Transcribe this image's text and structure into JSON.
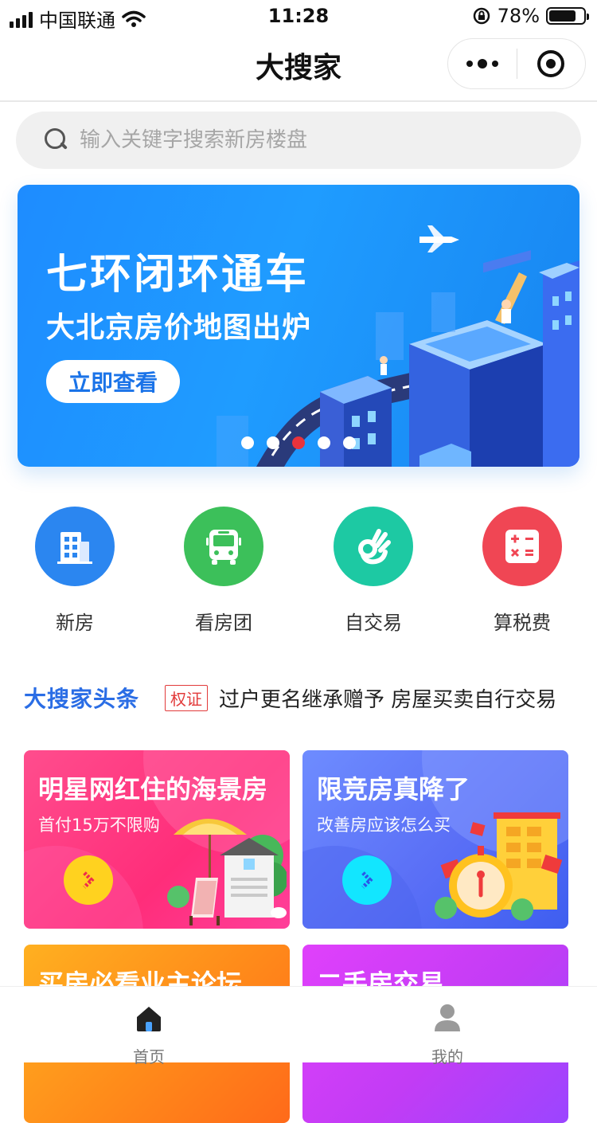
{
  "status_bar": {
    "carrier": "中国联通",
    "time": "11:28",
    "battery_pct": "78%",
    "battery_level": 0.78
  },
  "nav": {
    "title": "大搜家"
  },
  "search": {
    "placeholder": "输入关键字搜索新房楼盘"
  },
  "banner": {
    "title": "七环闭环通车",
    "subtitle": "大北京房价地图出炉",
    "cta": "立即查看",
    "dot_count": 5,
    "active_dot": 3,
    "colors": {
      "bg": "#1e8cff",
      "active_dot": "#e8333c"
    }
  },
  "quick_entries": [
    {
      "label": "新房",
      "icon": "building-icon",
      "color": "#2b86f0"
    },
    {
      "label": "看房团",
      "icon": "bus-icon",
      "color": "#3cc05a"
    },
    {
      "label": "自交易",
      "icon": "ok-hand-icon",
      "color": "#1dc9a3"
    },
    {
      "label": "算税费",
      "icon": "calculator-icon",
      "color": "#f04654"
    }
  ],
  "headline": {
    "brand": "大搜家头条",
    "tag": "权证",
    "text": "过户更名继承赠予 房屋买卖自行交易"
  },
  "cards": [
    {
      "title": "明星网红住的海景房",
      "subtitle": "首付15万不限购"
    },
    {
      "title": "限竞房真降了",
      "subtitle": "改善房应该怎么买"
    },
    {
      "title": "买房必看业主论坛",
      "subtitle": ""
    },
    {
      "title": "二手房交易",
      "subtitle": ""
    }
  ],
  "tabbar": {
    "items": [
      {
        "label": "首页",
        "icon": "home-icon",
        "active": true
      },
      {
        "label": "我的",
        "icon": "user-icon",
        "active": false
      }
    ]
  }
}
